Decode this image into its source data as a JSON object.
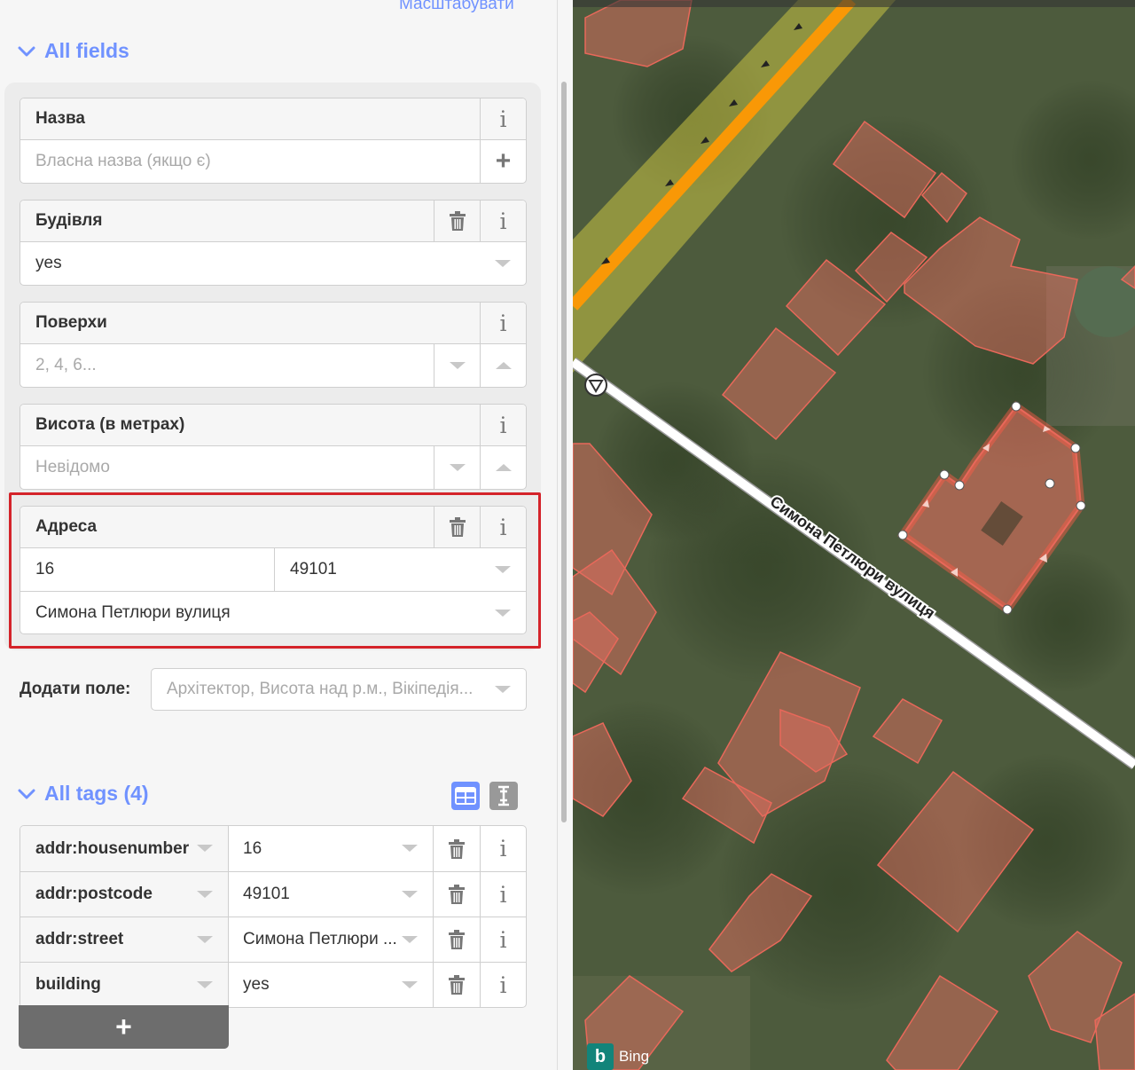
{
  "header": {
    "zoom_link": "Масштабувати"
  },
  "all_fields": {
    "title": "All fields",
    "name_field": {
      "label": "Назва",
      "placeholder": "Власна назва (якщо є)"
    },
    "building_field": {
      "label": "Будівля",
      "value": "yes"
    },
    "levels_field": {
      "label": "Поверхи",
      "placeholder": "2, 4, 6..."
    },
    "height_field": {
      "label": "Висота (в метрах)",
      "placeholder": "Невідомо"
    },
    "address_field": {
      "label": "Адреса",
      "housenumber": "16",
      "postcode": "49101",
      "street": "Симона Петлюри вулиця"
    },
    "add_field": {
      "label": "Додати поле:",
      "placeholder": "Архітектор, Висота над р.м., Вікіпедія..."
    }
  },
  "all_tags": {
    "title": "All tags (4)",
    "rows": [
      {
        "key": "addr:housenumber",
        "value": "16"
      },
      {
        "key": "addr:postcode",
        "value": "49101"
      },
      {
        "key": "addr:street",
        "value": "Симона Петлюри ..."
      },
      {
        "key": "building",
        "value": "yes"
      }
    ],
    "add_button": "+"
  },
  "map": {
    "street_label": "Симона Петлюри вулиця",
    "attribution": "Bing",
    "colors": {
      "building_fill": "#e06e5f",
      "building_stroke": "#e8685a",
      "primary_road": "#f99806",
      "residential_road": "#ffffff",
      "selection": "#ff5a47"
    }
  },
  "colors": {
    "accent": "#7092ff",
    "highlight_box": "#d4232a"
  }
}
